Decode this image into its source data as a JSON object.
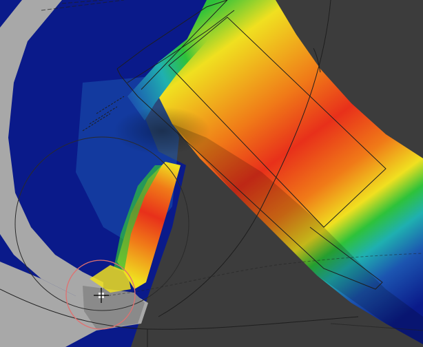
{
  "viewport": {
    "background_color": "#3c3c3c",
    "mode": "weight-paint",
    "weight_colors": {
      "zero": "#0a1a8a",
      "low": "#1c55b0",
      "mid_low": "#1fb0b0",
      "mid": "#2ec23a",
      "mid_high": "#f0e020",
      "high": "#f07a18",
      "full": "#e8301a"
    }
  },
  "brush": {
    "cursor_icon": "crosshair-icon",
    "outer_circle_color": "#2a2a2a",
    "inner_circle_color": "#e07070"
  },
  "mesh": {
    "unpainted_color": "#a8a8a8",
    "wire_color": "#1e1e1e"
  }
}
